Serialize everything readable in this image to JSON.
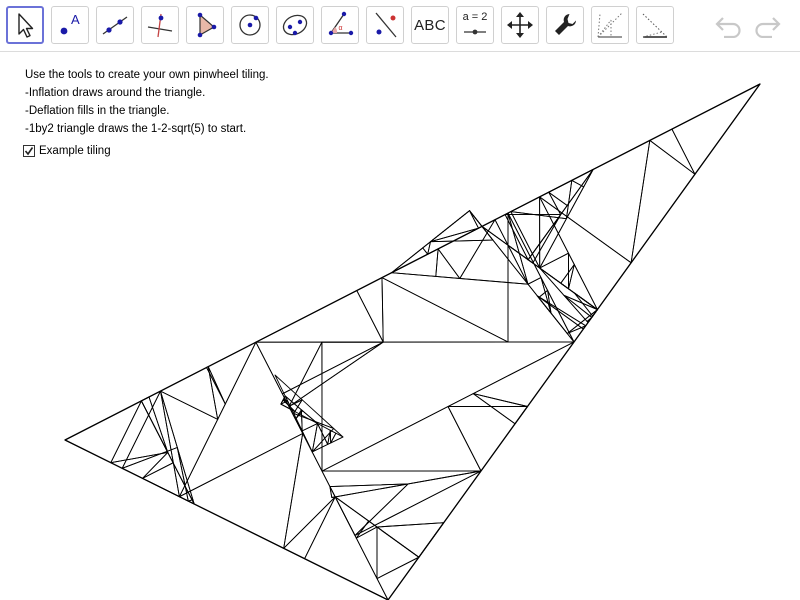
{
  "toolbar": {
    "tools": [
      {
        "name": "move",
        "label": ""
      },
      {
        "name": "point",
        "label": "A"
      },
      {
        "name": "line",
        "label": ""
      },
      {
        "name": "perpendicular-line",
        "label": ""
      },
      {
        "name": "polygon",
        "label": ""
      },
      {
        "name": "circle-center-point",
        "label": ""
      },
      {
        "name": "ellipse",
        "label": ""
      },
      {
        "name": "angle",
        "label": ""
      },
      {
        "name": "reflect",
        "label": ""
      },
      {
        "name": "text",
        "label": "ABC"
      },
      {
        "name": "slider",
        "label": "a = 2"
      },
      {
        "name": "move-graphics-view",
        "label": ""
      },
      {
        "name": "tools-settings",
        "label": ""
      },
      {
        "name": "custom-tool-1",
        "label": ""
      },
      {
        "name": "custom-tool-2",
        "label": ""
      }
    ],
    "active_tool": "move",
    "undo_icon": "undo-icon",
    "redo_icon": "redo-icon",
    "accent_color": "#6b72d8",
    "point_color": "#1a1aa8"
  },
  "instructions": {
    "line1": "Use the tools to create your own pinwheel tiling.",
    "line2": "-Inflation draws around the triangle.",
    "line3": "-Deflation fills in the triangle.",
    "line4": "-1by2 triangle draws the 1-2-sqrt(5) to start."
  },
  "example_tiling": {
    "label": "Example tiling",
    "checked": true
  }
}
